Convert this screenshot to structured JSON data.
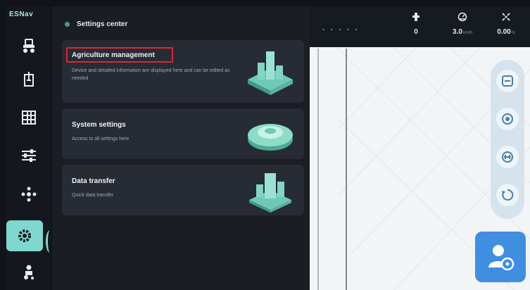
{
  "app": {
    "brand": "ESNav"
  },
  "panel": {
    "title": "Settings center",
    "cards": [
      {
        "title": "Agriculture management",
        "description": "Device and detailed information are displayed here and can be edited as needed",
        "highlighted": true,
        "illustration": "building-stack-icon"
      },
      {
        "title": "System settings",
        "description": "Access to all settings here",
        "highlighted": false,
        "illustration": "gear-disc-icon"
      },
      {
        "title": "Data transfer",
        "description": "Quick data transfer",
        "highlighted": false,
        "illustration": "data-tower-icon"
      }
    ]
  },
  "rail": {
    "items": [
      {
        "icon": "tractor-icon"
      },
      {
        "icon": "implement-icon"
      },
      {
        "icon": "field-grid-icon"
      },
      {
        "icon": "sliders-icon"
      },
      {
        "icon": "network-icon"
      },
      {
        "icon": "settings-icon",
        "active": true
      },
      {
        "icon": "user-tractor-icon"
      }
    ]
  },
  "status": {
    "signal_dots": "• • • • •",
    "satellites": {
      "icon": "satellite-icon",
      "value": "0"
    },
    "speed": {
      "icon": "speedometer-icon",
      "value": "3.0",
      "unit": "km/h"
    },
    "accuracy": {
      "icon": "crosshair-icon",
      "value": "0.00",
      "unit": "m"
    }
  },
  "tools": [
    {
      "icon": "map-layer-icon"
    },
    {
      "icon": "camera-icon"
    },
    {
      "icon": "track-icon"
    },
    {
      "icon": "recenter-icon"
    }
  ],
  "colors": {
    "accent": "#7fd8cf",
    "highlight": "#e0262e",
    "avatar_bg": "#3f8ee0"
  }
}
